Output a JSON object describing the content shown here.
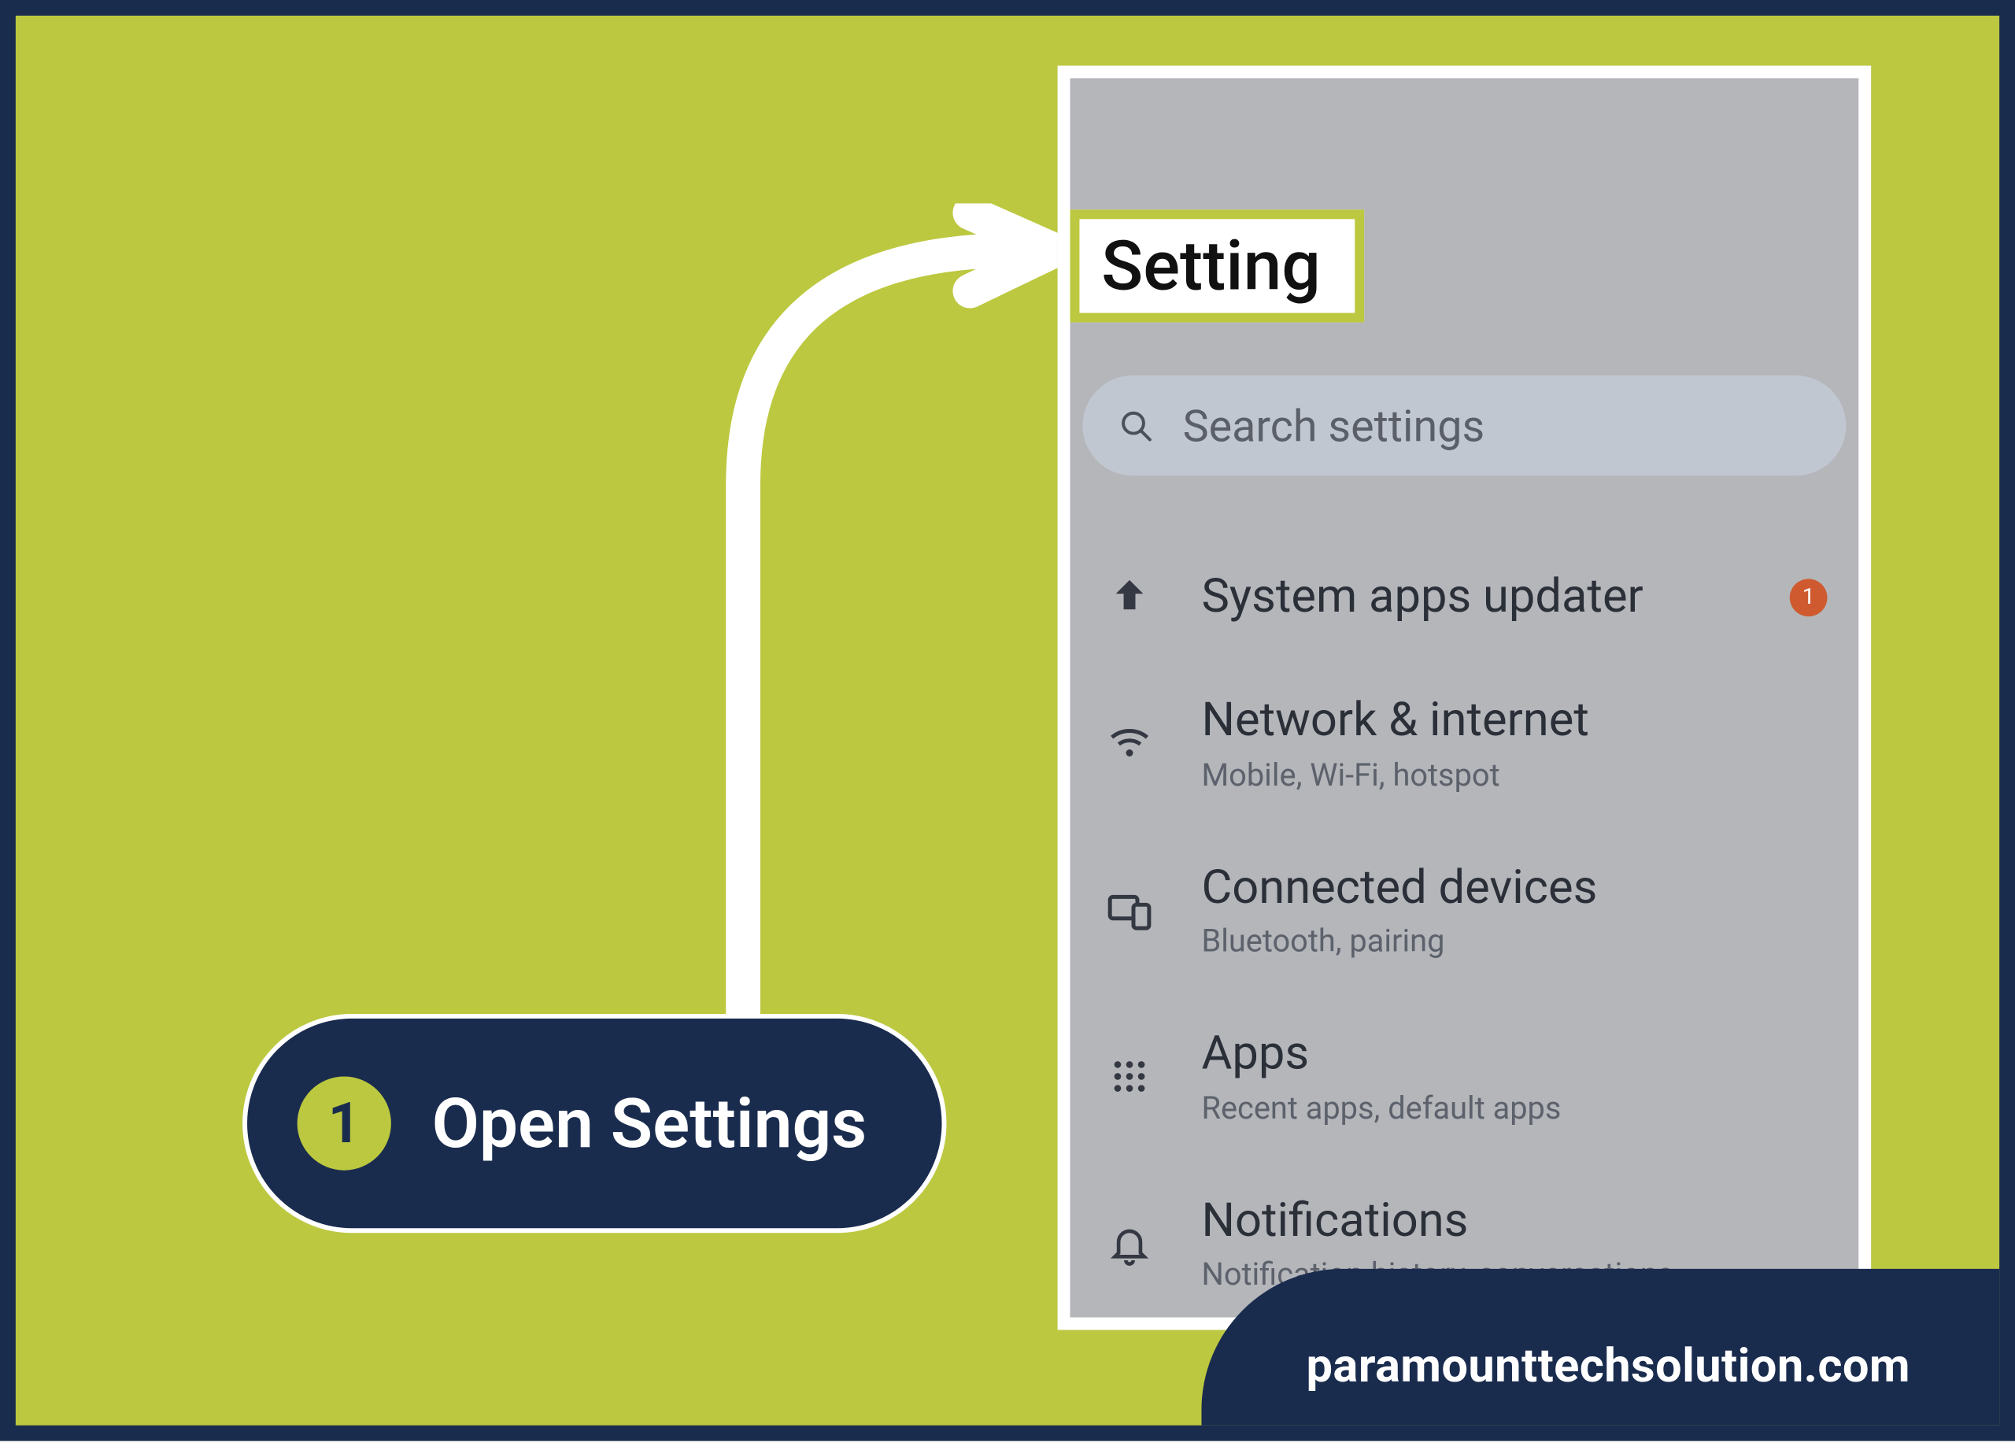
{
  "step": {
    "number": "1",
    "label": "Open Settings"
  },
  "phone": {
    "title": "Setting",
    "search_placeholder": "Search settings",
    "rows": [
      {
        "label": "System apps updater",
        "sub": "",
        "badge": "1"
      },
      {
        "label": "Network & internet",
        "sub": "Mobile, Wi-Fi, hotspot"
      },
      {
        "label": "Connected devices",
        "sub": "Bluetooth, pairing"
      },
      {
        "label": "Apps",
        "sub": "Recent apps, default apps"
      },
      {
        "label": "Notifications",
        "sub": "Notification history, conversations"
      }
    ]
  },
  "footer": "paramounttechsolution.com"
}
